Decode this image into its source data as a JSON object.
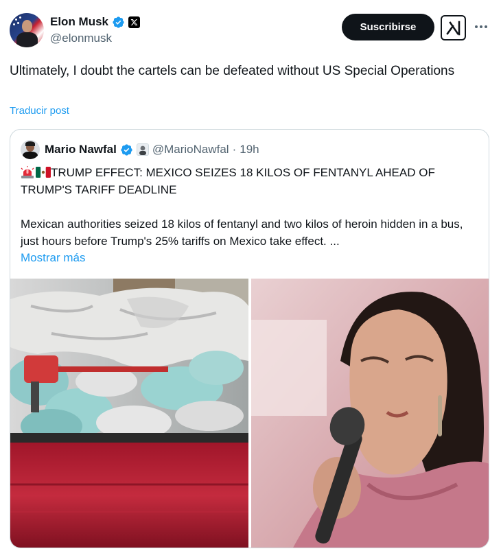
{
  "post": {
    "author": {
      "name": "Elon Musk",
      "handle": "@elonmusk",
      "verified": true
    },
    "subscribe_label": "Suscribirse",
    "text": "Ultimately, I doubt the cartels can be defeated without US Special Operations",
    "translate_label": "Traducir post"
  },
  "quote": {
    "author": {
      "name": "Mario Nawfal",
      "handle": "@MarioNawfal",
      "separator": "·",
      "time": "19h",
      "verified": true
    },
    "headline": "TRUMP EFFECT:  MEXICO SEIZES 18 KILOS OF FENTANYL AHEAD OF TRUMP'S TARIFF DEADLINE",
    "emojis": [
      "police-light-emoji",
      "mexico-flag-emoji"
    ],
    "body": "Mexican authorities seized 18 kilos of fentanyl and two kilos of heroin hidden in a bus, just hours before Trump's 25% tariffs on Mexico take effect. ...",
    "show_more_label": "Mostrar más",
    "media": [
      {
        "name": "seized-drugs-photo"
      },
      {
        "name": "speaker-with-microphone-photo"
      }
    ]
  },
  "colors": {
    "accent": "#1d9bf0",
    "text": "#0f1419",
    "muted": "#536471",
    "border": "#cfd9de"
  }
}
